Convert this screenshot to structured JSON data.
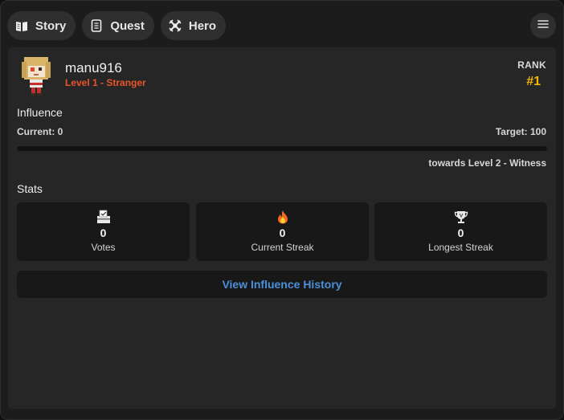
{
  "tabs": [
    {
      "label": "Story",
      "icon": "book-icon"
    },
    {
      "label": "Quest",
      "icon": "scroll-icon"
    },
    {
      "label": "Hero",
      "icon": "crossed-swords-icon"
    }
  ],
  "menu": {
    "icon": "hamburger-menu-icon"
  },
  "profile": {
    "username": "manu916",
    "level": "Level 1 - Stranger",
    "rank_label": "RANK",
    "rank_value": "#1",
    "avatar": "pixel-hero-avatar"
  },
  "influence": {
    "title": "Influence",
    "current": "Current: 0",
    "target": "Target: 100",
    "progress": 0,
    "towards": "towards Level 2 - Witness"
  },
  "stats": {
    "title": "Stats",
    "items": [
      {
        "value": "0",
        "label": "Votes",
        "icon": "ballot-box-icon"
      },
      {
        "value": "0",
        "label": "Current Streak",
        "icon": "fire-icon"
      },
      {
        "value": "0",
        "label": "Longest Streak",
        "icon": "trophy-icon"
      }
    ]
  },
  "history_button": "View Influence History",
  "colors": {
    "accent_orange": "#e8552a",
    "rank_gold": "#f2b705",
    "link_blue": "#4a90d9"
  }
}
